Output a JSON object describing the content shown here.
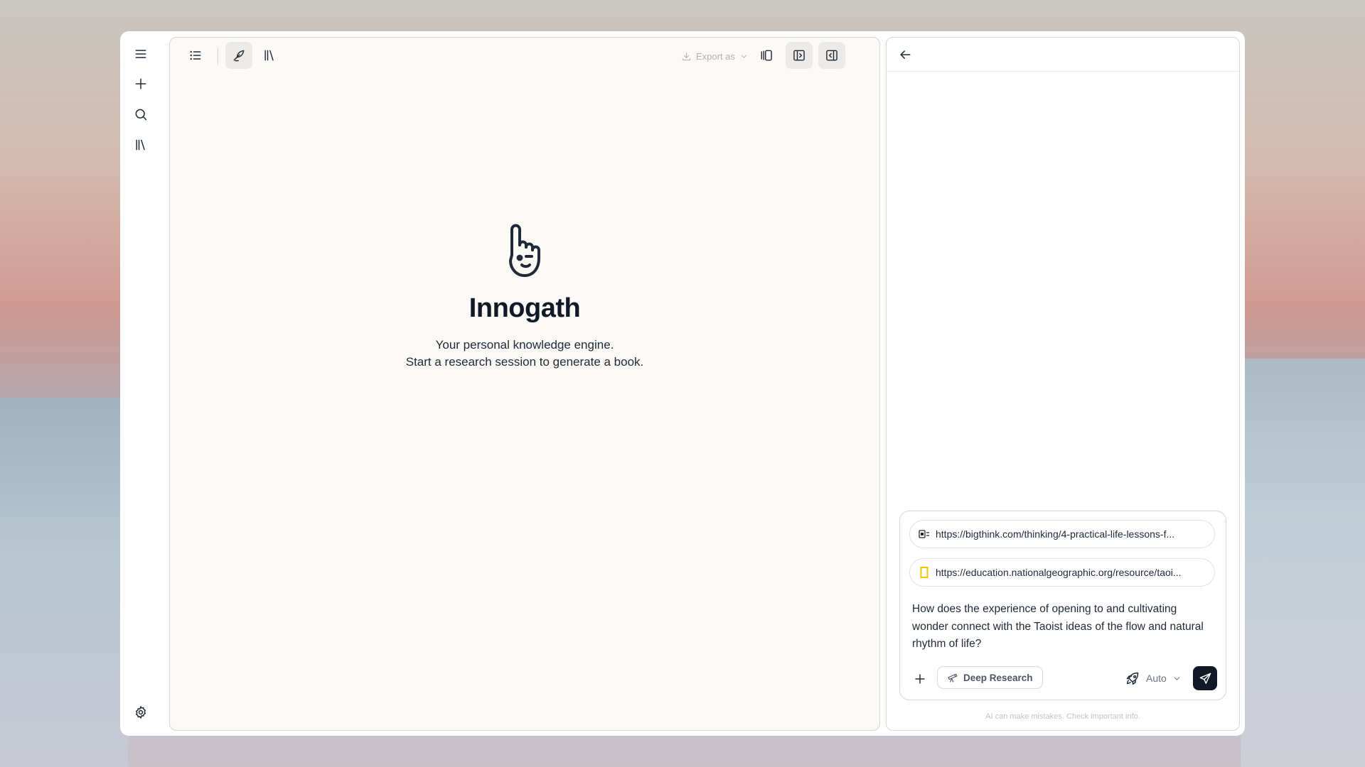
{
  "toolbar": {
    "export_label": "Export as"
  },
  "hero": {
    "title": "Innogath",
    "subtitle_line1": "Your personal knowledge engine.",
    "subtitle_line2": "Start a research session to generate a book."
  },
  "chat": {
    "sources": [
      {
        "url": "https://bigthink.com/thinking/4-practical-life-lessons-f...",
        "icon": "bigthink-favicon-icon"
      },
      {
        "url": "https://education.nationalgeographic.org/resource/taoi...",
        "icon": "natgeo-favicon-icon",
        "icon_color": "#f5c400"
      }
    ],
    "prompt": "How does the experience of opening to and cultivating wonder connect with the Taoist ideas of the flow and natural rhythm of life?",
    "deep_research_label": "Deep Research",
    "model_label": "Auto",
    "disclaimer": "AI can make mistakes. Check important info."
  },
  "colors": {
    "accent": "#111827",
    "editor_bg": "#faf9f6",
    "natgeo_yellow": "#f5c400"
  }
}
